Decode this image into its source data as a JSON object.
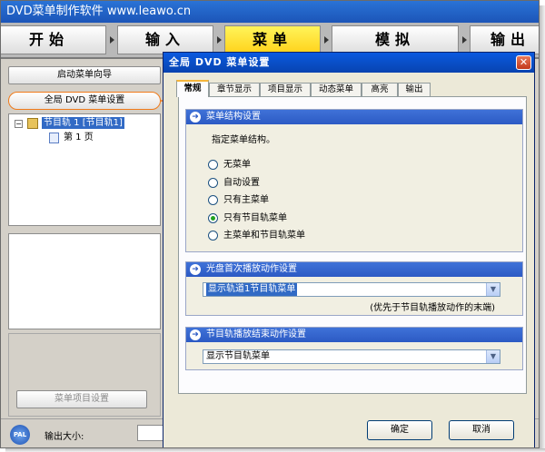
{
  "app": {
    "title": "DVD菜单制作软件 www.leawo.cn"
  },
  "steps": [
    {
      "label": "开始"
    },
    {
      "label": "输入"
    },
    {
      "label": "菜单"
    },
    {
      "label": "模拟"
    },
    {
      "label": "输出"
    }
  ],
  "left_panel": {
    "wizard_button": "启动菜单向导",
    "global_settings_button": "全局 DVD 菜单设置",
    "tree": {
      "track": "节目轨 1 [节目轨1]",
      "page": "第 1 页"
    },
    "item_settings_button": "菜单项目设置"
  },
  "footer": {
    "pal_badge": "PAL",
    "output_size_label": "输出大小:"
  },
  "dialog": {
    "title": "全局 DVD 菜单设置",
    "close_icon": "close-icon",
    "tabs": [
      {
        "label": "常规"
      },
      {
        "label": "章节显示"
      },
      {
        "label": "项目显示"
      },
      {
        "label": "动态菜单"
      },
      {
        "label": "高亮"
      },
      {
        "label": "输出"
      }
    ],
    "menu_structure": {
      "heading": "菜单结构设置",
      "instruction": "指定菜单结构。",
      "options": [
        {
          "label": "无菜单",
          "selected": false
        },
        {
          "label": "自动设置",
          "selected": false
        },
        {
          "label": "只有主菜单",
          "selected": false
        },
        {
          "label": "只有节目轨菜单",
          "selected": true
        },
        {
          "label": "主菜单和节目轨菜单",
          "selected": false
        }
      ]
    },
    "first_play": {
      "heading": "光盘首次播放动作设置",
      "value": "显示轨道1节目轨菜单",
      "note": "(优先于节目轨播放动作的末端)"
    },
    "track_end": {
      "heading": "节目轨播放结束动作设置",
      "value": "显示节目轨菜单"
    },
    "ok_button": "确定",
    "cancel_button": "取消"
  },
  "colors": {
    "accent_orange": "#f07a1a",
    "active_step": "#ffd21a",
    "dialog_title": "#0a5adf"
  }
}
